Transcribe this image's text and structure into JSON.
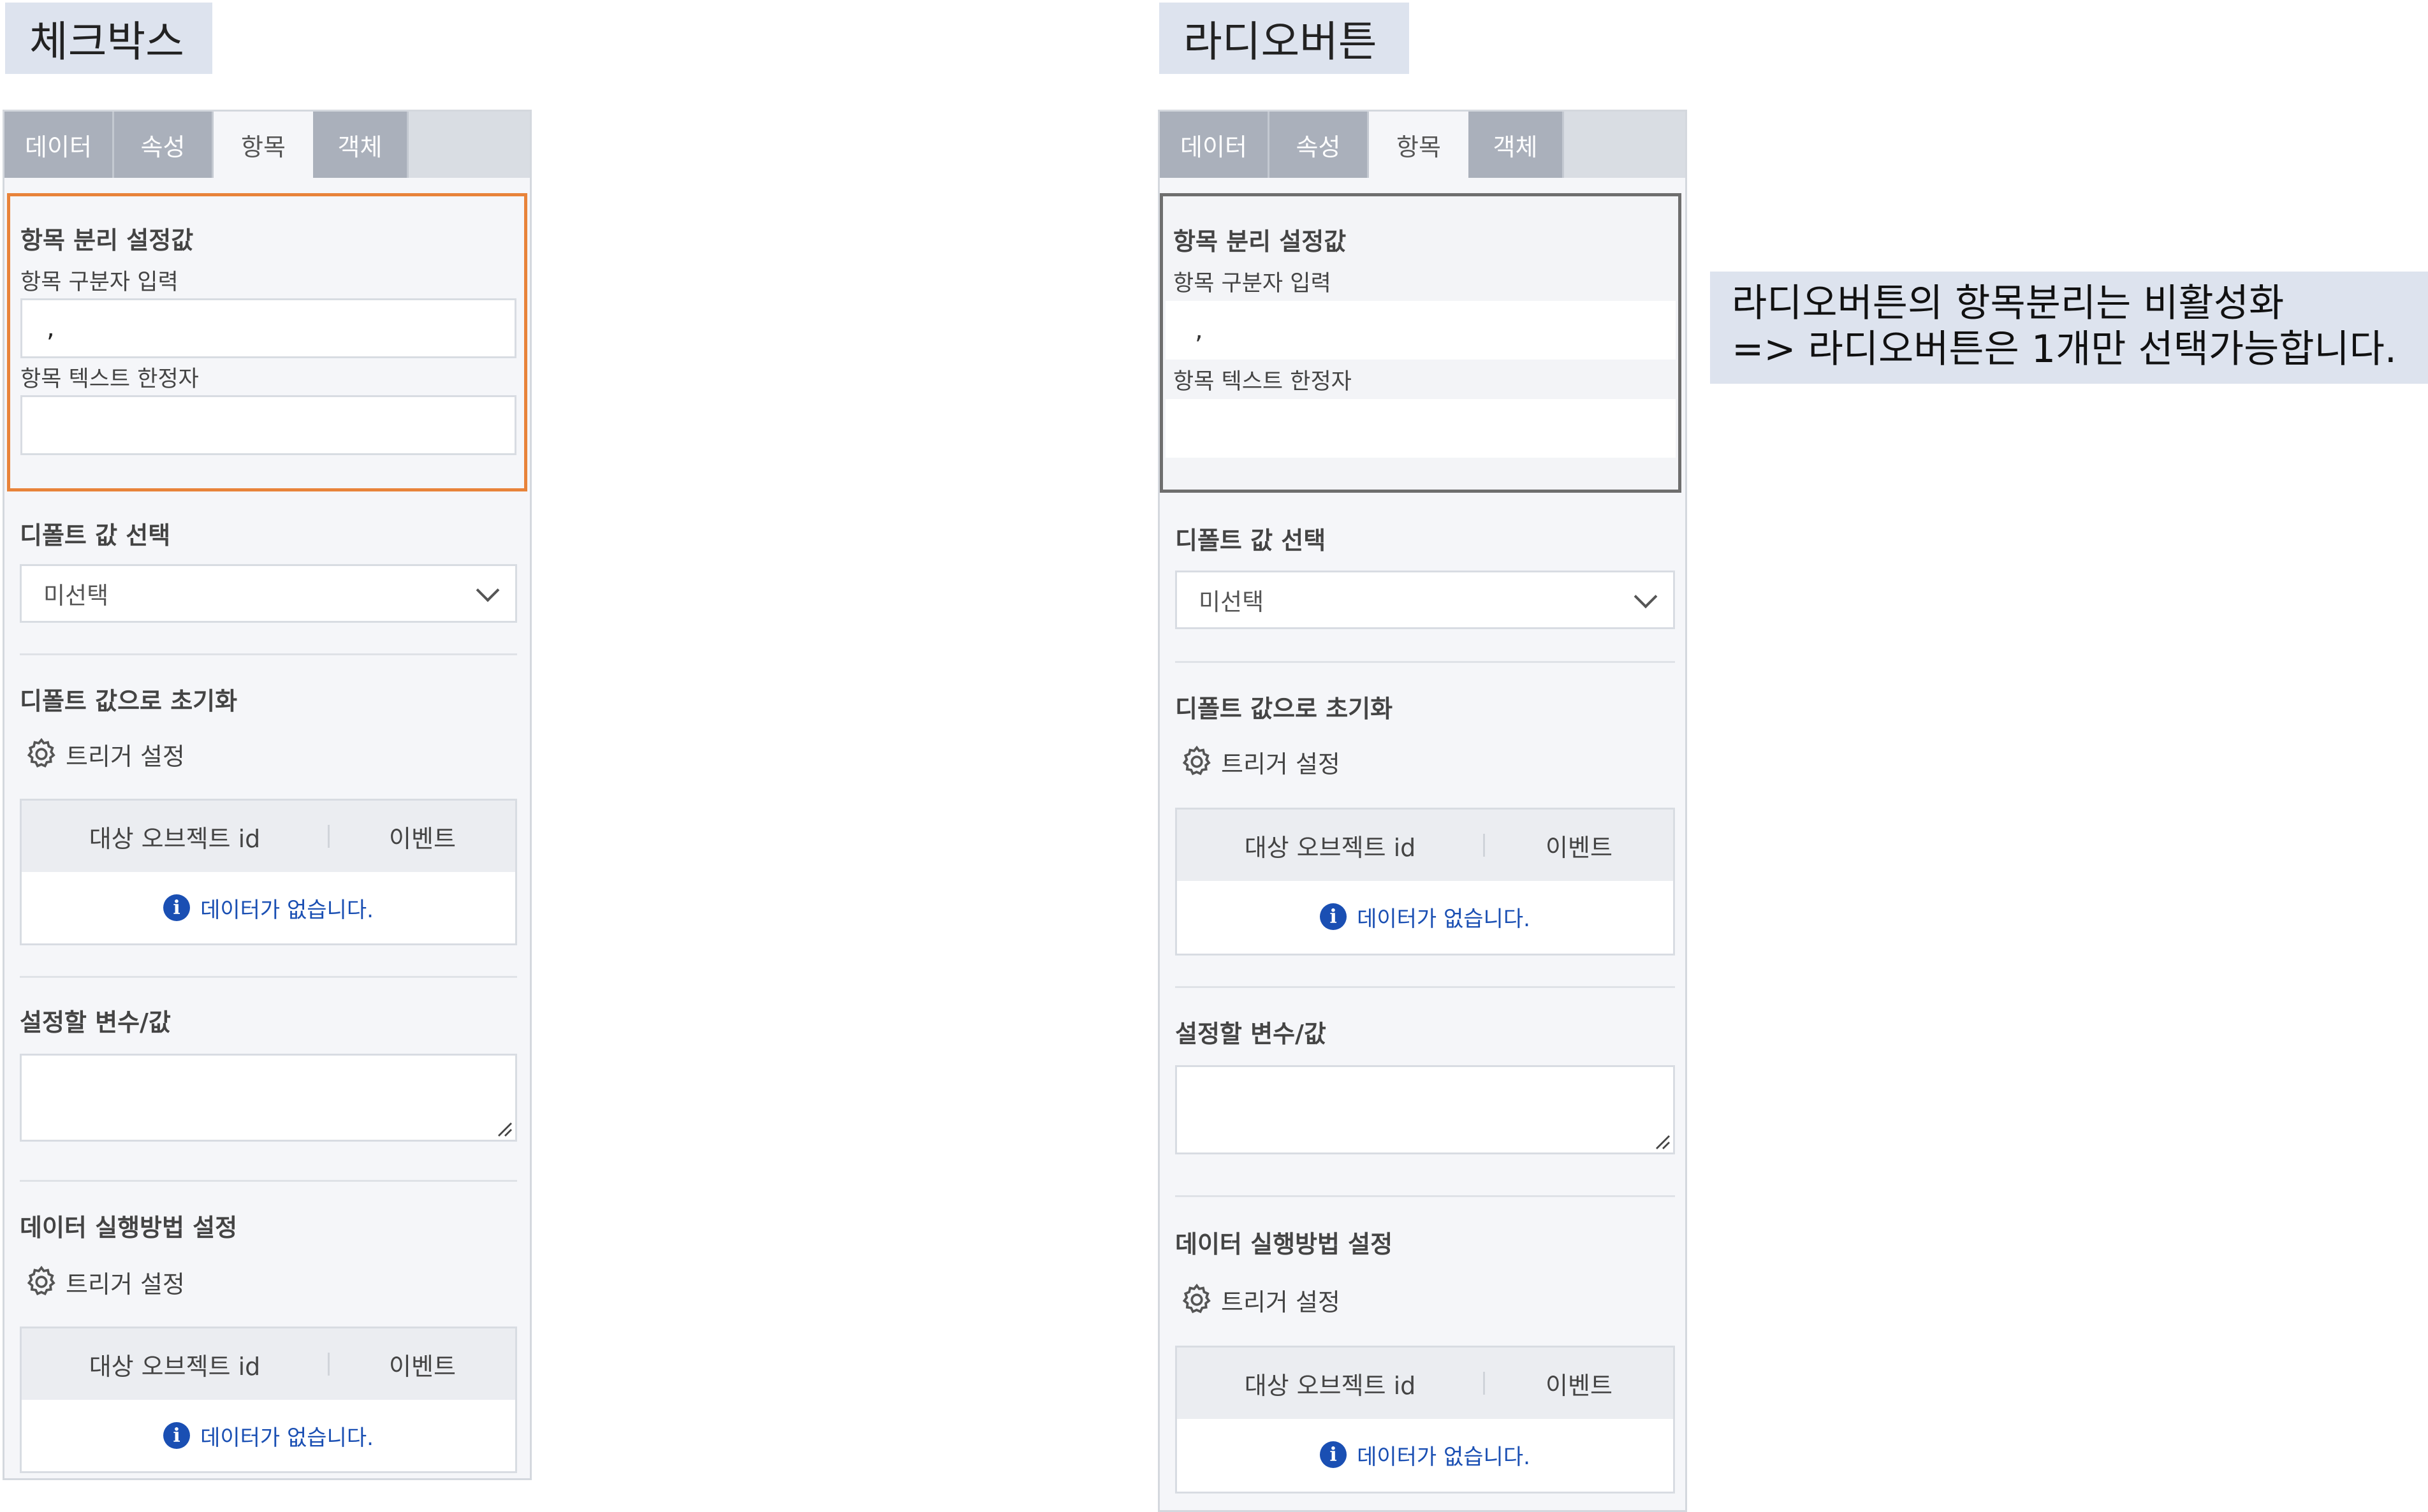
{
  "left": {
    "title": "체크박스",
    "tabs": [
      "데이터",
      "속성",
      "항목",
      "객체"
    ],
    "separator_section": {
      "title": "항목 분리 설정값",
      "delimiter_label": "항목 구분자 입력",
      "delimiter_value": ",",
      "qualifier_label": "항목 텍스트 한정자",
      "qualifier_value": ""
    },
    "default_select": {
      "label": "디폴트 값 선택",
      "value": "미선택"
    },
    "reset_section": {
      "label": "디폴트 값으로 초기화",
      "trigger_label": "트리거 설정",
      "col1": "대상 오브젝트 id",
      "col2": "이벤트",
      "empty": "데이터가 없습니다."
    },
    "variable_section": {
      "label": "설정할 변수/값"
    },
    "exec_section": {
      "label": "데이터 실행방법 설정",
      "trigger_label": "트리거 설정",
      "col1": "대상 오브젝트 id",
      "col2": "이벤트",
      "empty": "데이터가 없습니다."
    }
  },
  "right": {
    "title": "라디오버튼",
    "tabs": [
      "데이터",
      "속성",
      "항목",
      "객체"
    ],
    "separator_section": {
      "title": "항목 분리 설정값",
      "delimiter_label": "항목 구분자 입력",
      "delimiter_value": ",",
      "qualifier_label": "항목 텍스트 한정자",
      "qualifier_value": ""
    },
    "default_select": {
      "label": "디폴트 값 선택",
      "value": "미선택"
    },
    "reset_section": {
      "label": "디폴트 값으로 초기화",
      "trigger_label": "트리거 설정",
      "col1": "대상 오브젝트 id",
      "col2": "이벤트",
      "empty": "데이터가 없습니다."
    },
    "variable_section": {
      "label": "설정할 변수/값"
    },
    "exec_section": {
      "label": "데이터 실행방법 설정",
      "trigger_label": "트리거 설정",
      "col1": "대상 오브젝트 id",
      "col2": "이벤트",
      "empty": "데이터가 없습니다."
    }
  },
  "note": {
    "line1": "라디오버튼의 항목분리는 비활성화",
    "line2": "=> 라디오버튼은 1개만 선택가능합니다."
  },
  "colors": {
    "highlight_border": "#e8833a",
    "disabled_border": "#6e6e6e",
    "info_blue": "#1a4fb3",
    "title_bg": "#dde3ee"
  },
  "icons": {
    "gear": "gear-icon",
    "info": "info-icon",
    "chevron": "chevron-down-icon"
  }
}
